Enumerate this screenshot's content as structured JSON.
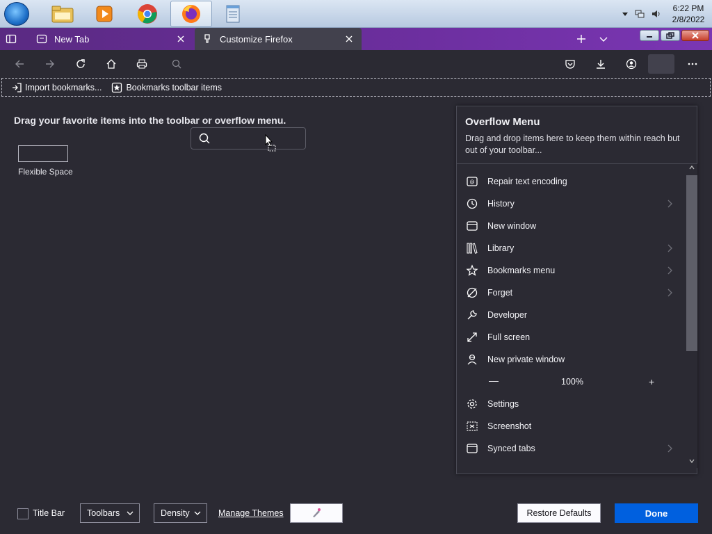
{
  "taskbar": {
    "apps": [
      "windows-explorer",
      "media-player",
      "chrome",
      "firefox",
      "notepad"
    ],
    "clock_time": "6:22 PM",
    "clock_date": "2/8/2022"
  },
  "tabs": [
    {
      "label": "New Tab"
    },
    {
      "label": "Customize Firefox"
    }
  ],
  "bookmarks": {
    "import_label": "Import bookmarks...",
    "toolbar_items_label": "Bookmarks toolbar items"
  },
  "palette": {
    "hint": "Drag your favorite items into the toolbar or overflow menu.",
    "flexible_space_label": "Flexible Space"
  },
  "overflow": {
    "title": "Overflow Menu",
    "description": "Drag and drop items here to keep them within reach but out of your toolbar...",
    "items": [
      {
        "label": "Repair text encoding",
        "icon": "encoding-icon",
        "submenu": false
      },
      {
        "label": "History",
        "icon": "history-icon",
        "submenu": true
      },
      {
        "label": "New window",
        "icon": "window-icon",
        "submenu": false
      },
      {
        "label": "Library",
        "icon": "library-icon",
        "submenu": true
      },
      {
        "label": "Bookmarks menu",
        "icon": "star-icon",
        "submenu": true
      },
      {
        "label": "Forget",
        "icon": "forget-icon",
        "submenu": true
      },
      {
        "label": "Developer",
        "icon": "wrench-icon",
        "submenu": false
      },
      {
        "label": "Full screen",
        "icon": "fullscreen-icon",
        "submenu": false
      },
      {
        "label": "New private window",
        "icon": "private-icon",
        "submenu": false
      },
      {
        "label": "100%",
        "type": "zoom"
      },
      {
        "label": "Settings",
        "icon": "gear-icon",
        "submenu": false
      },
      {
        "label": "Screenshot",
        "icon": "screenshot-icon",
        "submenu": false
      },
      {
        "label": "Synced tabs",
        "icon": "synced-tabs-icon",
        "submenu": true
      }
    ]
  },
  "footer": {
    "title_bar_label": "Title Bar",
    "toolbars_label": "Toolbars",
    "density_label": "Density",
    "manage_themes_label": "Manage Themes",
    "restore_label": "Restore Defaults",
    "done_label": "Done"
  },
  "colors": {
    "background": "#2b2a33",
    "tabbar": "#6d2fa0",
    "done_button": "#0060df"
  }
}
